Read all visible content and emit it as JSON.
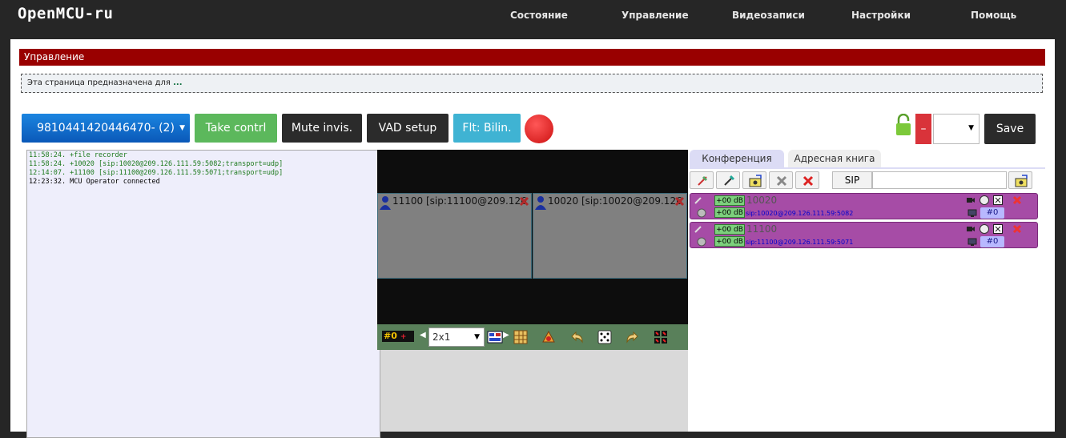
{
  "brand": "OpenMCU-ru",
  "nav": [
    "Состояние",
    "Управление",
    "Видеозаписи",
    "Настройки",
    "Помощь"
  ],
  "section_title": "Управление",
  "info": {
    "text": "Эта страница предназначена для",
    "more": "..."
  },
  "toolbar": {
    "conference": "9810441420446470- (2)",
    "take_control": "Take contrl",
    "mute_invisible": "Mute invis.",
    "vad_setup": "VAD setup",
    "filter": "Flt: Bilin.",
    "minus": "–",
    "save": "Save"
  },
  "log": [
    {
      "time": "11:58:24.",
      "text": " +file recorder",
      "color": "green"
    },
    {
      "time": "11:58:24.",
      "text": " +10020 [sip:10020@209.126.111.59:5082;transport=udp]",
      "color": "green"
    },
    {
      "time": "12:14:07.",
      "text": " +11100 [sip:11100@209.126.111.59:5071;transport=udp]",
      "color": "green"
    },
    {
      "time": "12:23:32.",
      "text": " MCU Operator connected",
      "color": "black"
    }
  ],
  "video": {
    "tiles": [
      {
        "label": "11100 [sip:11100@209.126"
      },
      {
        "label": "10020 [sip:10020@209.126"
      }
    ],
    "position": "#0",
    "layout": "2x1"
  },
  "tabs": {
    "conference": "Конференция",
    "address_book": "Адресная книга"
  },
  "sip_label": "SIP",
  "members": [
    {
      "gain_in": "+00 dB",
      "gain_out": "+00 dB",
      "name": "10020",
      "address": "sip:10020@209.126.111.59:5082",
      "pos": "#0"
    },
    {
      "gain_in": "+00 dB",
      "gain_out": "+00 dB",
      "name": "11100",
      "address": "sip:11100@209.126.111.59:5071",
      "pos": "#0"
    }
  ],
  "colors": {
    "header": "#990000",
    "member": "#a64ca6",
    "primary": "#0a6ed1",
    "success": "#5cb85c",
    "info": "#3fb3d3"
  }
}
